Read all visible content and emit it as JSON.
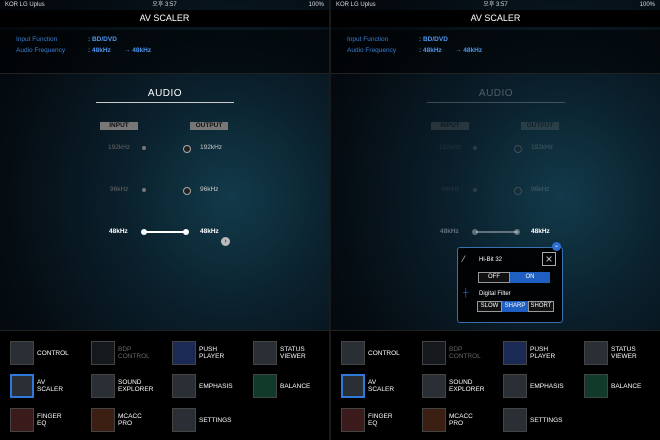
{
  "status": {
    "carrier": "KOR LG Uplus",
    "time": "오후 3:57",
    "battery": "100%"
  },
  "title": "AV SCALER",
  "info": {
    "input_label": "Input Function",
    "input_value": ": BD/DVD",
    "freq_label": "Audio Frequency",
    "freq_value": ": 48kHz",
    "freq_out": "→ 48kHz"
  },
  "audio": {
    "title": "AUDIO",
    "input_header": "INPUT",
    "output_header": "OUTPUT",
    "input_freqs": [
      "192kHz",
      "96kHz",
      "48kHz"
    ],
    "output_freqs": [
      "192kHz",
      "96kHz",
      "48kHz"
    ],
    "next_icon": "chevron-right-icon"
  },
  "popup": {
    "hibit_label": "Hi-Bit 32",
    "off": "OFF",
    "on": "ON",
    "filter_label": "Digital Filter",
    "slow": "SLOW",
    "sharp": "SHARP",
    "short": "SHORT",
    "hibit_state": "ON",
    "filter_state": "SHARP"
  },
  "menu": {
    "control": "CONTROL",
    "bdp_control_line1": "BDP",
    "bdp_control_line2": "CONTROL",
    "push_player": "PUSH PLAYER",
    "status_viewer_line1": "STATUS",
    "status_viewer_line2": "VIEWER",
    "av_scaler": "AV SCALER",
    "sound_explorer_line1": "SOUND",
    "sound_explorer_line2": "EXPLORER",
    "emphasis": "EMPHASIS",
    "balance": "BALANCE",
    "finger_eq": "FINGER EQ",
    "mcacc_pro": "MCACC PRO",
    "settings": "SETTINGS"
  },
  "colors": {
    "accent": "#2f7ad8",
    "info_text": "#4f96ee",
    "background": "#050c12"
  }
}
